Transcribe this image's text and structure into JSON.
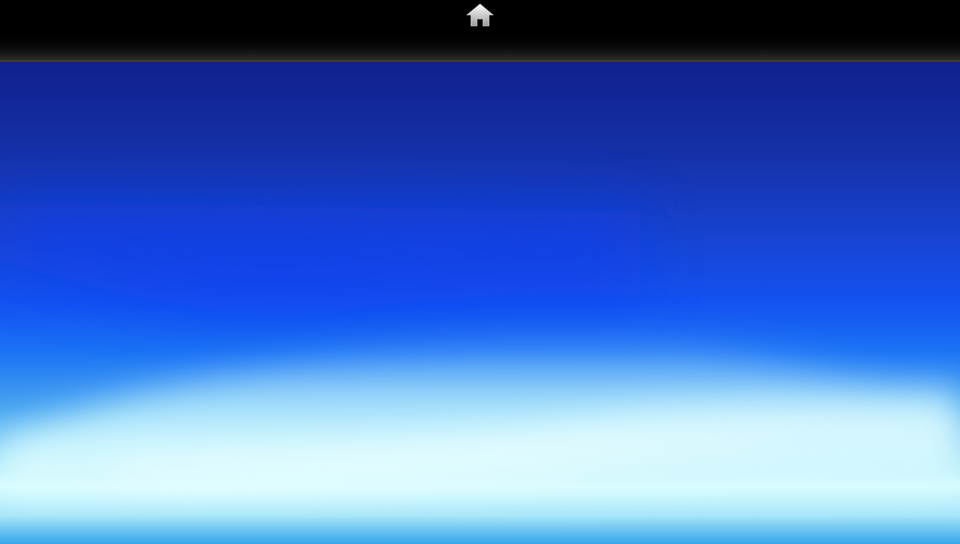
{
  "top_bar": {
    "home_icon": "home-icon",
    "background_color": "#000000"
  },
  "wallpaper": {
    "colors": [
      "#10208c",
      "#1452f2",
      "#d4fbff",
      "#37a6ea"
    ]
  }
}
